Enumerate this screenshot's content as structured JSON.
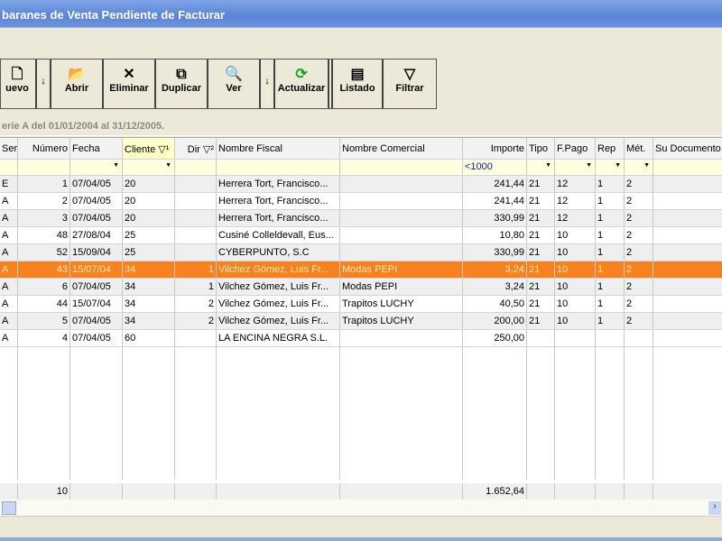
{
  "window": {
    "title": "baranes de Venta Pendiente de Facturar"
  },
  "toolbar": {
    "nuevo": "uevo",
    "abrir": "Abrir",
    "eliminar": "Eliminar",
    "duplicar": "Duplicar",
    "ver": "Ver",
    "actualizar": "Actualizar",
    "listado": "Listado",
    "filtrar": "Filtrar"
  },
  "subtitle": "erie A del 01/01/2004 al 31/12/2005.",
  "columns": [
    "Ser",
    "Número",
    "Fecha",
    "Cliente ▽¹",
    "Dir  ▽²",
    "Nombre Fiscal",
    "Nombre Comercial",
    "Importe",
    "Tipo",
    "F.Pago",
    "Rep",
    "Mét.",
    "Su Documento"
  ],
  "filters": {
    "importe": "<1000"
  },
  "rows": [
    [
      "E",
      "1",
      "07/04/05",
      "20",
      "",
      "Herrera Tort, Francisco...",
      "",
      "241,44",
      "21",
      "12",
      "1",
      "2",
      ""
    ],
    [
      "A",
      "2",
      "07/04/05",
      "20",
      "",
      "Herrera Tort, Francisco...",
      "",
      "241,44",
      "21",
      "12",
      "1",
      "2",
      ""
    ],
    [
      "A",
      "3",
      "07/04/05",
      "20",
      "",
      "Herrera Tort, Francisco...",
      "",
      "330,99",
      "21",
      "12",
      "1",
      "2",
      ""
    ],
    [
      "A",
      "48",
      "27/08/04",
      "25",
      "",
      "Cusiné Colleldevall, Eus...",
      "",
      "10,80",
      "21",
      "10",
      "1",
      "2",
      ""
    ],
    [
      "A",
      "52",
      "15/09/04",
      "25",
      "",
      "CYBERPUNTO, S.C",
      "",
      "330,99",
      "21",
      "10",
      "1",
      "2",
      ""
    ],
    [
      "A",
      "43",
      "15/07/04",
      "34",
      "1",
      "Vilchez Gómez, Luis Fr...",
      "Modas PEPI",
      "3,24",
      "21",
      "10",
      "1",
      "2",
      ""
    ],
    [
      "A",
      "6",
      "07/04/05",
      "34",
      "1",
      "Vilchez Gómez, Luis Fr...",
      "Modas PEPI",
      "3,24",
      "21",
      "10",
      "1",
      "2",
      ""
    ],
    [
      "A",
      "44",
      "15/07/04",
      "34",
      "2",
      "Vilchez Gómez, Luis Fr...",
      "Trapitos LUCHY",
      "40,50",
      "21",
      "10",
      "1",
      "2",
      ""
    ],
    [
      "A",
      "5",
      "07/04/05",
      "34",
      "2",
      "Vilchez Gómez, Luis Fr...",
      "Trapitos LUCHY",
      "200,00",
      "21",
      "10",
      "1",
      "2",
      ""
    ],
    [
      "A",
      "4",
      "07/04/05",
      "60",
      "",
      "LA ENCINA NEGRA S.L.",
      "",
      "250,00",
      "",
      "",
      "",
      "",
      ""
    ]
  ],
  "selected_row": 5,
  "totals": {
    "count": "10",
    "importe": "1.652,64"
  }
}
